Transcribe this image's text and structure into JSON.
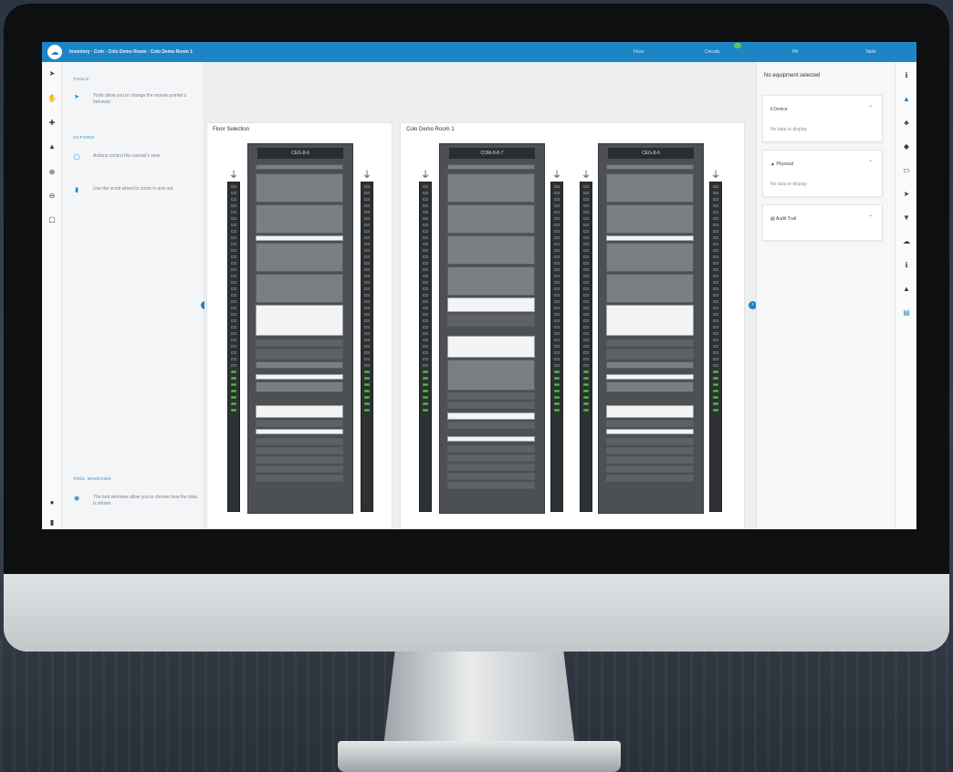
{
  "app": {
    "logo_glyph": "☁",
    "breadcrumb": "Inventory · Colo · Colo Demo Room · Colo Demo Room 1",
    "top_items": [
      "Floor",
      "Circuits",
      "PA",
      "Table"
    ],
    "accent": "#1c85c6"
  },
  "left_toolbar": {
    "icons": [
      "pointer-icon",
      "hand-icon",
      "move-icon",
      "layers-icon",
      "zoom-in-icon",
      "zoom-out-icon",
      "fit-icon"
    ],
    "glyphs": [
      "➤",
      "✋",
      "✚",
      "▲",
      "⊕",
      "⊖",
      "▢"
    ],
    "bottom_glyphs": [
      "●",
      "▮"
    ]
  },
  "tools_panel": {
    "sections": [
      {
        "title": "TOOLS",
        "tips": [
          {
            "glyph": "➤",
            "text": "Tools allow you to change the mouse pointer's behavior"
          }
        ]
      },
      {
        "title": "ACTIONS",
        "tips": [
          {
            "glyph": "▢",
            "text": "Actions control the canvas's view"
          },
          {
            "glyph": "▮",
            "text": "Use the scroll wheel to zoom in and out"
          }
        ]
      },
      {
        "title": "TOOL WINDOWS",
        "tips": [
          {
            "glyph": "◉",
            "text": "The tool windows allow you to choose how the data is shown"
          }
        ]
      }
    ]
  },
  "main": {
    "panels": [
      {
        "title": "Floor Selection",
        "racks": [
          {
            "name": "CEG-8-6"
          }
        ]
      },
      {
        "title": "Colo Demo Room 1",
        "racks": [
          {
            "name": "COM-8-8-7"
          },
          {
            "name": "CEG-8-6"
          }
        ]
      }
    ]
  },
  "right_panel": {
    "header": "No equipment selected",
    "cards": [
      {
        "title": "Device",
        "glyph": "ℹ",
        "body": "No data to display"
      },
      {
        "title": "Physical",
        "glyph": "▲",
        "body": "No data to display"
      },
      {
        "title": "Audit Trail",
        "glyph": "▤",
        "body": ""
      }
    ],
    "chevron": "⌃"
  },
  "right_toolbar": {
    "glyphs": [
      "ℹ",
      "▲",
      "♣",
      "◆",
      "▭",
      "➤",
      "▼",
      "☁",
      "ℹ",
      "▲",
      "▤"
    ]
  }
}
